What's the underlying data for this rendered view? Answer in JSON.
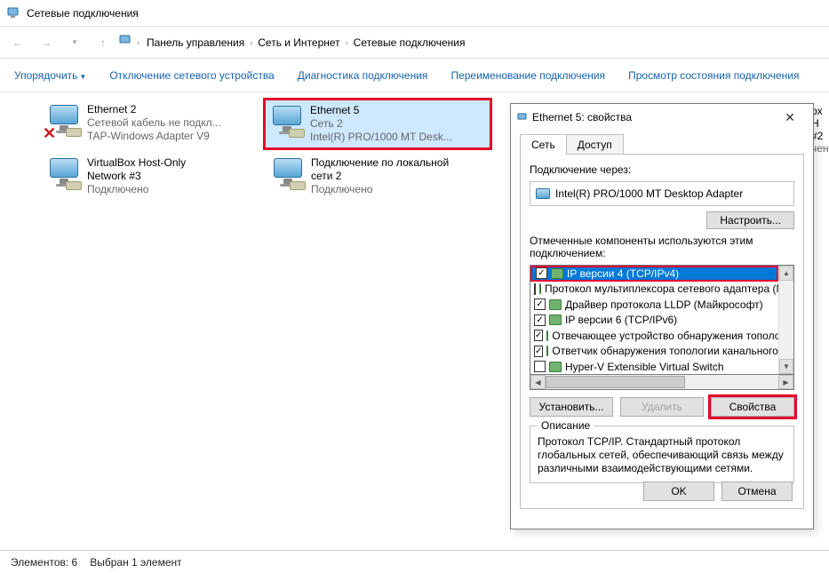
{
  "window_title": "Сетевые подключения",
  "breadcrumbs": [
    "Панель управления",
    "Сеть и Интернет",
    "Сетевые подключения"
  ],
  "toolbar": {
    "organize": "Упорядочить",
    "disable": "Отключение сетевого устройства",
    "diagnose": "Диагностика подключения",
    "rename": "Переименование подключения",
    "view_status": "Просмотр состояния подключения"
  },
  "connections": [
    {
      "name": "Ethernet 2",
      "line2": "Сетевой кабель не подкл...",
      "line3": "TAP-Windows Adapter V9",
      "disabled": true
    },
    {
      "name": "Ethernet 5",
      "line2": "Сеть 2",
      "line3": "Intel(R) PRO/1000 MT Desk...",
      "selected": true
    },
    {
      "name": "VirtualBox Host-Only Network #3",
      "line2": "Подключено",
      "line3": ""
    },
    {
      "name": "Подключение по локальной сети 2",
      "line2": "Подключено",
      "line3": ""
    }
  ],
  "behind": {
    "l1": "ox H",
    "l2": "#2",
    "l3": "чен"
  },
  "status": {
    "elements": "Элементов: 6",
    "selected": "Выбран 1 элемент"
  },
  "dialog": {
    "title": "Ethernet 5: свойства",
    "tabs": {
      "net": "Сеть",
      "access": "Доступ"
    },
    "connect_via_label": "Подключение через:",
    "adapter": "Intel(R) PRO/1000 MT Desktop Adapter",
    "configure_btn": "Настроить...",
    "components_label": "Отмеченные компоненты используются этим подключением:",
    "components": [
      {
        "checked": true,
        "label": "IP версии 4 (TCP/IPv4)",
        "selected": true
      },
      {
        "checked": false,
        "label": "Протокол мультиплексора сетевого адаптера (Ма"
      },
      {
        "checked": true,
        "label": "Драйвер протокола LLDP (Майкрософт)"
      },
      {
        "checked": true,
        "label": "IP версии 6 (TCP/IPv6)"
      },
      {
        "checked": true,
        "label": "Отвечающее устройство обнаружения топологии к"
      },
      {
        "checked": true,
        "label": "Ответчик обнаружения топологии канального уро"
      },
      {
        "checked": false,
        "label": "Hyper-V Extensible Virtual Switch"
      }
    ],
    "install_btn": "Установить...",
    "remove_btn": "Удалить",
    "props_btn": "Свойства",
    "desc_legend": "Описание",
    "desc_text": "Протокол TCP/IP. Стандартный протокол глобальных сетей, обеспечивающий связь между различными взаимодействующими сетями.",
    "ok": "OK",
    "cancel": "Отмена"
  }
}
